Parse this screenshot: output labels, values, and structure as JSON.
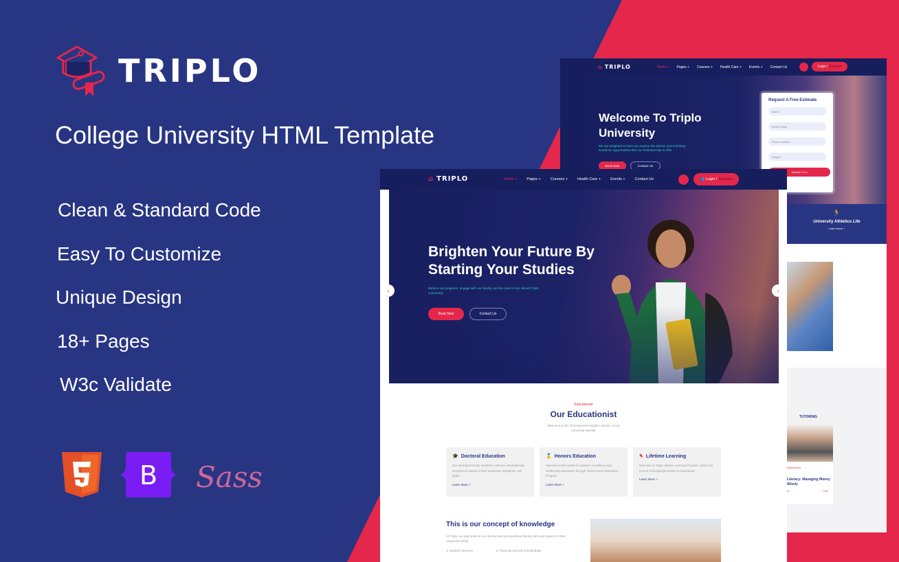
{
  "brand": {
    "name": "TRIPLO",
    "tagline": "College University HTML Template"
  },
  "features": [
    "Clean & Standard Code",
    "Easy To Customize",
    "Unique Design",
    "18+ Pages",
    "W3c Validate"
  ],
  "tech_logos": [
    {
      "icon": "html5-icon",
      "label": "5"
    },
    {
      "icon": "bootstrap-icon",
      "label": "B"
    },
    {
      "icon": "sass-icon",
      "label": "Sass"
    }
  ],
  "colors": {
    "navy": "#283583",
    "red": "#e4274a",
    "dark_navy": "#161e5e",
    "teal": "#2dd4bf"
  },
  "nav": {
    "logo": "TRIPLO",
    "items": [
      "Home +",
      "Pages +",
      "Courses +",
      "Health Care +",
      "Events +",
      "Contact Us"
    ],
    "login": "Login /",
    "register": "Register"
  },
  "back_mockup": {
    "hero_title_1": "Welcome To Triplo",
    "hero_title_2": "University",
    "hero_desc": "We are delighted to have you explore the diverse and enriching academic opportunities that our institution has to offer",
    "book_now": "Book Now",
    "contact_us": "Contact Us",
    "form": {
      "title": "Request A Free Estimate",
      "fields": [
        "Name",
        "Active Email",
        "Phone Number",
        "Subject"
      ],
      "submit": "Submit Form"
    },
    "athletics": {
      "title": "University Athletics Life",
      "link": "Learn More +"
    },
    "tutoring_label": "TUTORING",
    "course_card": {
      "author": "Manali Mosa",
      "title": "Literacy: Managing Money Wisely",
      "meta": "2k",
      "price": "Free"
    }
  },
  "front_mockup": {
    "hero_title_1": "Brighten Your Future By",
    "hero_title_2": "Starting Your Studies",
    "hero_desc": "Explore our programs, engage with our faculty, and be a part of our vibrant Triplo community",
    "book_now": "Book Now",
    "contact_us": "Contact Us",
    "section": {
      "eyebrow": "Educationist",
      "title": "Our Educationist",
      "desc_1": "Welcome to the \"Educationist Insights\" section of our",
      "desc_2": "university website"
    },
    "cards": [
      {
        "title": "Doctoral Education",
        "text": "Our dedicated faculty members, who are internationally recognized experts in their respective disciplines, will guide...",
        "link": "Learn More +"
      },
      {
        "title": "Honors Education",
        "text": "Welcome to the world of academic excellence and intellectual exploration through Triplo Honors Education Program",
        "link": "Learn More +"
      },
      {
        "title": "Lifetime Learning",
        "text": "Welcome to Triplo Lifetime Learning Program, where the pursuit of knowledge knows no boundaries",
        "link": "Learn More +"
      }
    ],
    "concept": {
      "title": "This is our concept of knowledge",
      "desc": "At Triplo, we take pride in our diverse and accomplished faculty who are experts in their respective fields.",
      "checks": [
        "Student Services",
        "Financial Aid and Scholarships"
      ]
    }
  }
}
